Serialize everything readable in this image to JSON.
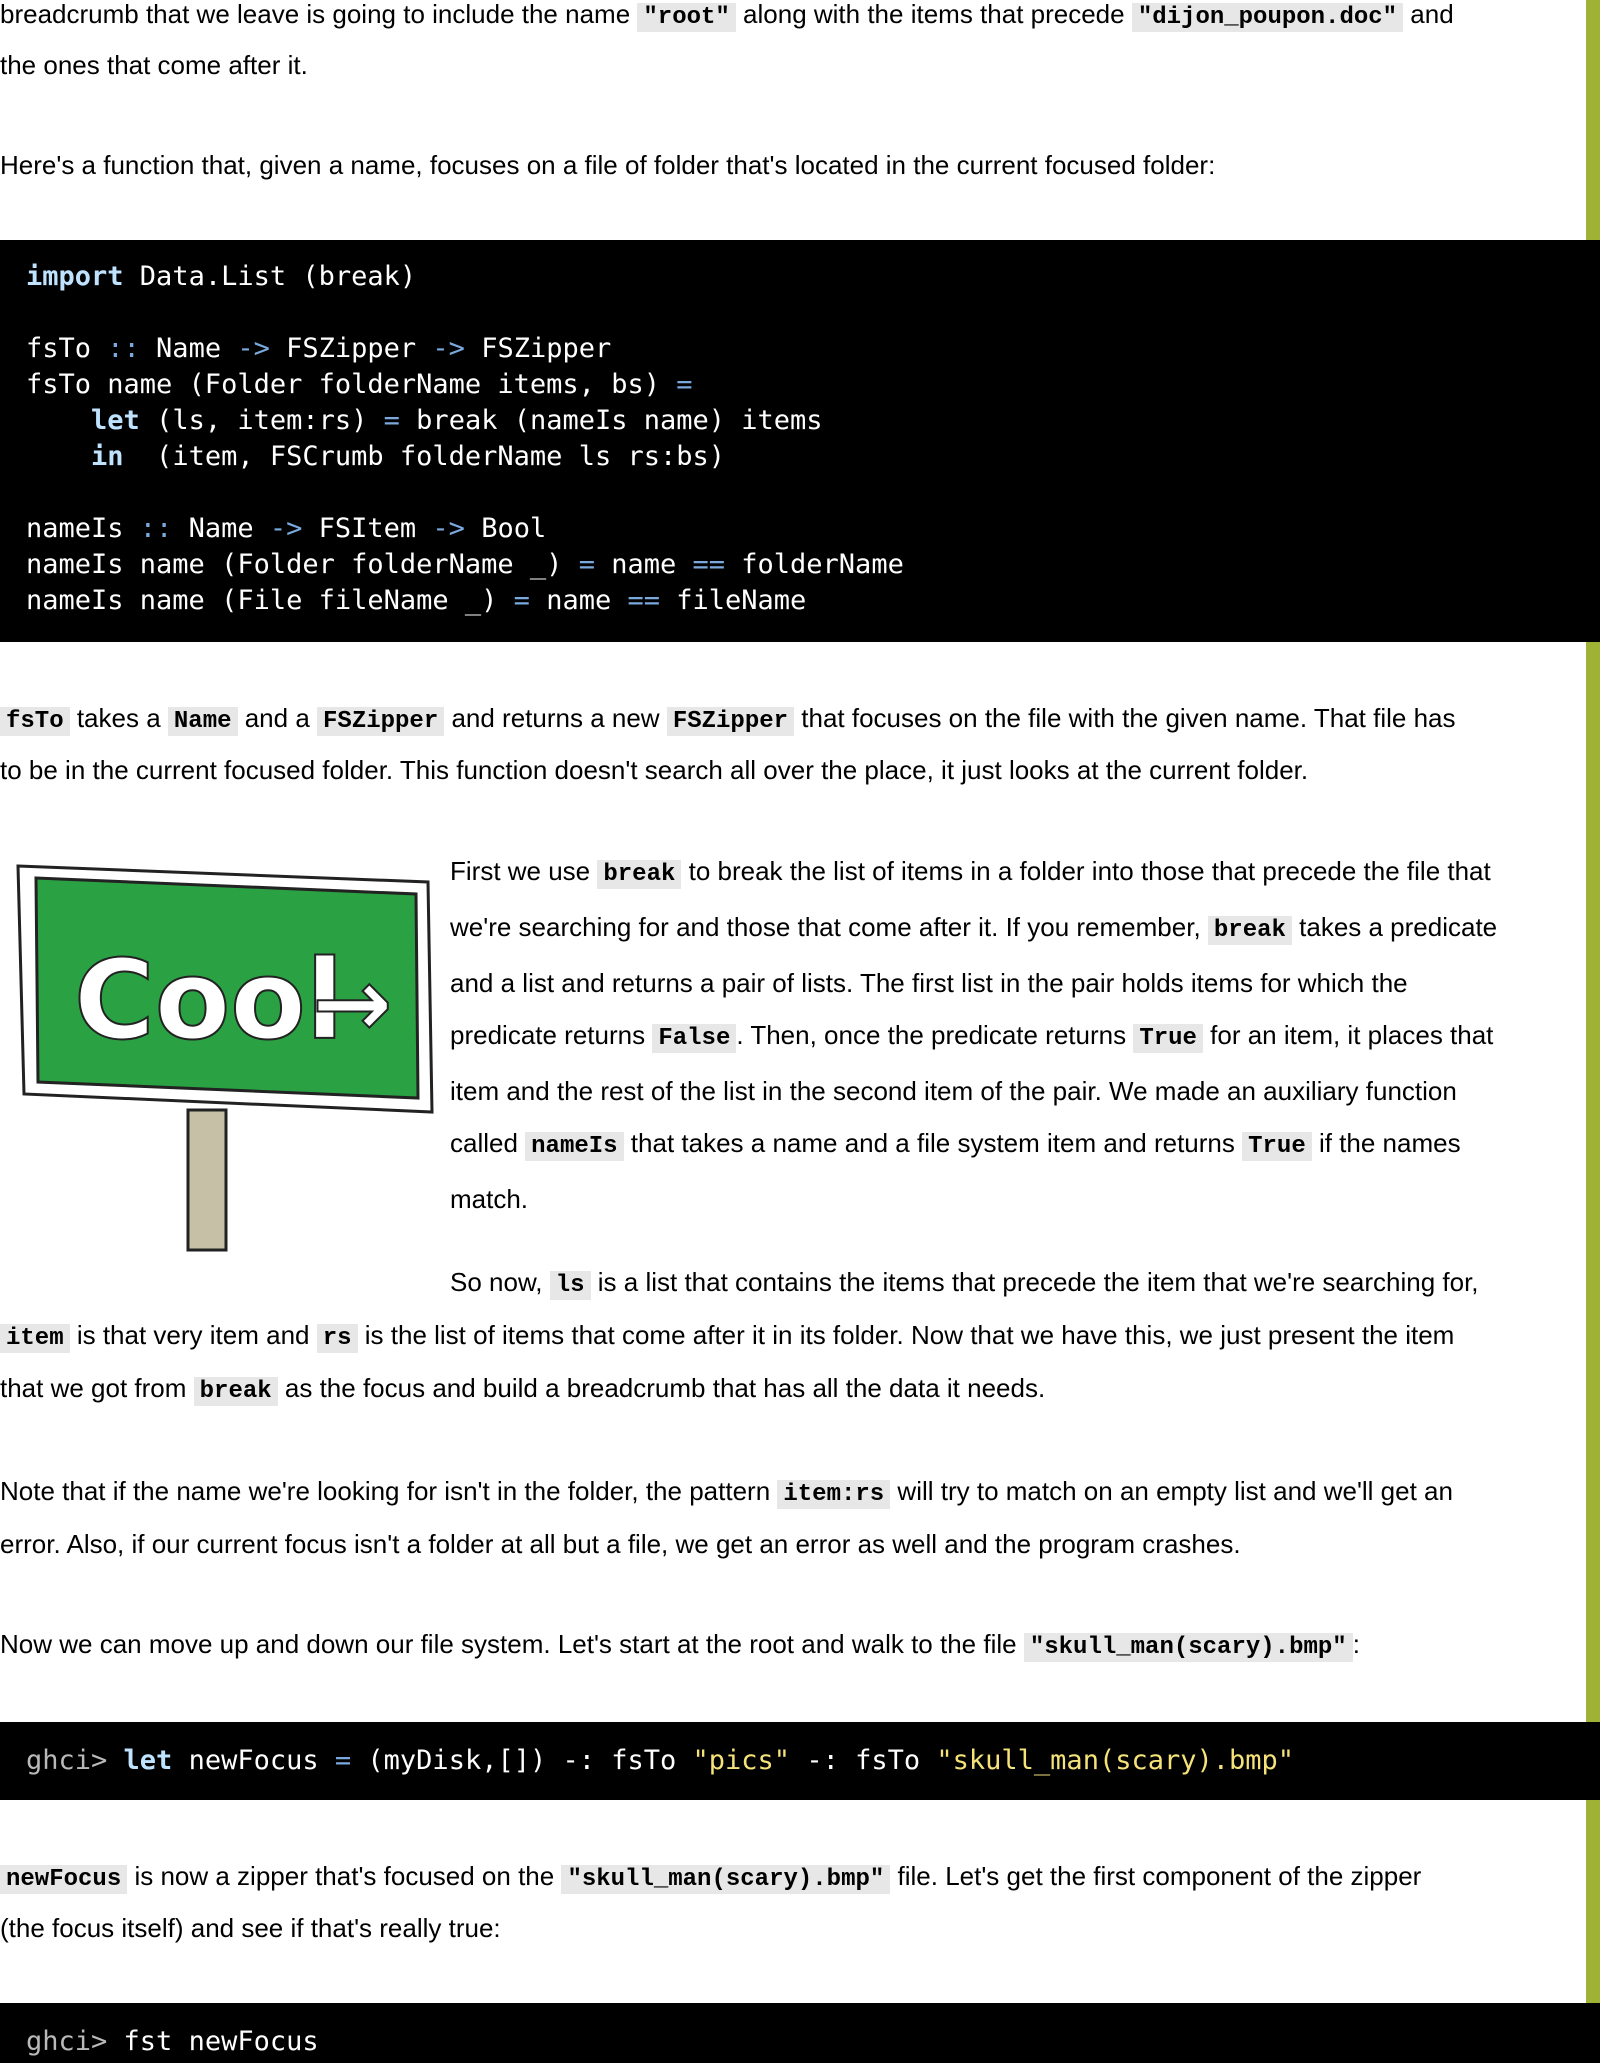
{
  "p_breadcrumb": [
    {
      "t": "breadcrumb that we leave is going to include the name "
    },
    {
      "c": "\"root\""
    },
    {
      "t": " along with the items that precede "
    },
    {
      "c": "\"dijon_poupon.doc\""
    },
    {
      "t": " and"
    }
  ],
  "p_breadcrumb2": [
    {
      "t": "the ones that come after it."
    }
  ],
  "p_function_intro": [
    {
      "t": "Here's a function that, given a name, focuses on a file of folder that's located in the current focused folder:"
    }
  ],
  "code_fsTo": [
    [
      {
        "k": "import"
      },
      {
        "t": " Data.List (break)"
      }
    ],
    [],
    [
      {
        "t": "fsTo "
      },
      {
        "o": "::"
      },
      {
        "t": " Name "
      },
      {
        "o": "->"
      },
      {
        "t": " FSZipper "
      },
      {
        "o": "->"
      },
      {
        "t": " FSZipper"
      }
    ],
    [
      {
        "t": "fsTo name (Folder folderName items, bs) "
      },
      {
        "o": "="
      }
    ],
    [
      {
        "t": "    "
      },
      {
        "k": "let"
      },
      {
        "t": " (ls, item:rs) "
      },
      {
        "o": "="
      },
      {
        "t": " break (nameIs name) items"
      }
    ],
    [
      {
        "t": "    "
      },
      {
        "k": "in"
      },
      {
        "t": "  (item, FSCrumb folderName ls rs:bs)"
      }
    ],
    [],
    [
      {
        "t": "nameIs "
      },
      {
        "o": "::"
      },
      {
        "t": " Name "
      },
      {
        "o": "->"
      },
      {
        "t": " FSItem "
      },
      {
        "o": "->"
      },
      {
        "t": " Bool"
      }
    ],
    [
      {
        "t": "nameIs name (Folder folderName _) "
      },
      {
        "o": "="
      },
      {
        "t": " name "
      },
      {
        "o": "=="
      },
      {
        "t": " folderName"
      }
    ],
    [
      {
        "t": "nameIs name (File fileName _) "
      },
      {
        "o": "="
      },
      {
        "t": " name "
      },
      {
        "o": "=="
      },
      {
        "t": " fileName"
      }
    ]
  ],
  "p_fsTo_1": [
    {
      "c": "fsTo"
    },
    {
      "t": " takes a "
    },
    {
      "c": "Name"
    },
    {
      "t": " and a "
    },
    {
      "c": "FSZipper"
    },
    {
      "t": " and returns a new "
    },
    {
      "c": "FSZipper"
    },
    {
      "t": " that focuses on the file with the given name. That file has"
    }
  ],
  "p_fsTo_2": [
    {
      "t": "to be in the current focused folder. This function doesn't search all over the place, it just looks at the current folder."
    }
  ],
  "sign_image": {
    "text": "Cool",
    "arrow": "→",
    "board_color": "#2aa244",
    "post_color": "#c6c1a6"
  },
  "p_break_lines": [
    [
      {
        "t": "First we use "
      },
      {
        "c": "break"
      },
      {
        "t": " to break the list of items in a folder into those that precede the file that"
      }
    ],
    [
      {
        "t": "we're searching for and those that come after it. If you remember, "
      },
      {
        "c": "break"
      },
      {
        "t": " takes a predicate"
      }
    ],
    [
      {
        "t": "and a list and returns a pair of lists. The first list in the pair holds items for which the"
      }
    ],
    [
      {
        "t": "predicate returns "
      },
      {
        "c": "False"
      },
      {
        "t": ". Then, once the predicate returns "
      },
      {
        "c": "True"
      },
      {
        "t": " for an item, it places that"
      }
    ],
    [
      {
        "t": "item and the rest of the list in the second item of the pair. We made an auxiliary function"
      }
    ],
    [
      {
        "t": "called "
      },
      {
        "c": "nameIs"
      },
      {
        "t": " that takes a name and a file system item and returns "
      },
      {
        "c": "True"
      },
      {
        "t": " if the names"
      }
    ],
    [
      {
        "t": "match."
      }
    ]
  ],
  "p_so_now_1": [
    {
      "t": "So now, "
    },
    {
      "c": "ls"
    },
    {
      "t": " is a list that contains the items that precede the item that we're searching for,"
    }
  ],
  "p_so_now_2": [
    {
      "c": "item"
    },
    {
      "t": " is that very item and "
    },
    {
      "c": "rs"
    },
    {
      "t": " is the list of items that come after it in its folder. Now that we have this, we just present the item"
    }
  ],
  "p_so_now_3": [
    {
      "t": "that we got from "
    },
    {
      "c": "break"
    },
    {
      "t": " as the focus and build a breadcrumb that has all the data it needs."
    }
  ],
  "p_note_1": [
    {
      "t": "Note that if the name we're looking for isn't in the folder, the pattern "
    },
    {
      "c": "item:rs"
    },
    {
      "t": " will try to match on an empty list and we'll get an"
    }
  ],
  "p_note_2": [
    {
      "t": "error. Also, if our current focus isn't a folder at all but a file, we get an error as well and the program crashes."
    }
  ],
  "p_move": [
    {
      "t": "Now we can move up and down our file system. Let's start at the root and walk to the file "
    },
    {
      "c": "\"skull_man(scary).bmp\""
    },
    {
      "t": ":"
    }
  ],
  "code_ghci1": [
    [
      {
        "p": "ghci> "
      },
      {
        "k": "let"
      },
      {
        "t": " newFocus "
      },
      {
        "o": "="
      },
      {
        "t": " (myDisk,[]) -: fsTo "
      },
      {
        "s": "\"pics\""
      },
      {
        "t": " -: fsTo "
      },
      {
        "s": "\"skull_man(scary).bmp\""
      }
    ]
  ],
  "p_newfocus_1": [
    {
      "c": "newFocus"
    },
    {
      "t": " is now a zipper that's focused on the "
    },
    {
      "c": "\"skull_man(scary).bmp\""
    },
    {
      "t": " file. Let's get the first component of the zipper"
    }
  ],
  "p_newfocus_2": [
    {
      "t": "(the focus itself) and see if that's really true:"
    }
  ],
  "code_ghci2": [
    [
      {
        "p": "ghci> "
      },
      {
        "t": "fst newFocus"
      }
    ]
  ],
  "colors": {
    "accent_bar": "#a0b236",
    "code_bg": "#000000",
    "inline_code_bg": "#e7e7e7"
  }
}
